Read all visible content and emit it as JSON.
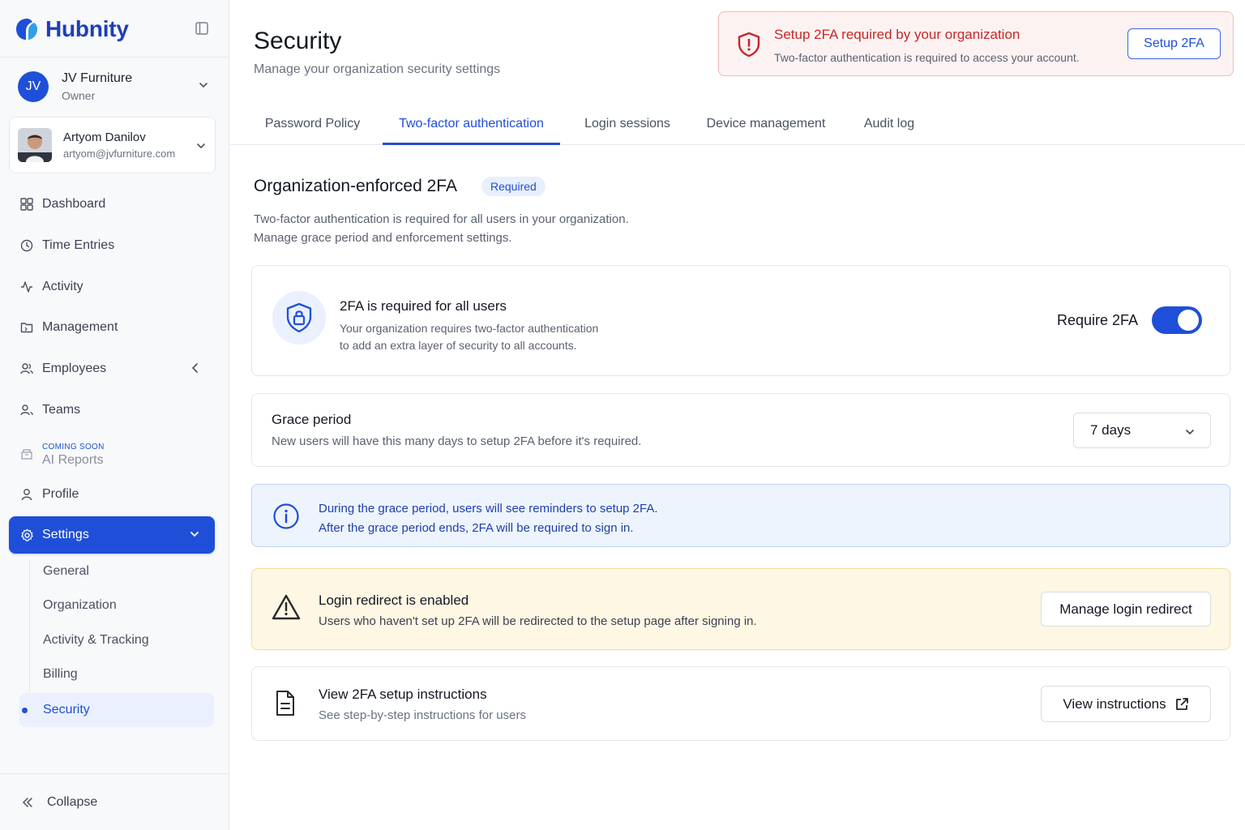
{
  "brand": {
    "name": "Hubnity",
    "accent": "#1f4fd8"
  },
  "org": {
    "initials": "JV",
    "name": "JV Furniture",
    "role": "Owner"
  },
  "user": {
    "name": "Artyom Danilov",
    "email": "artyom@jvfurniture.com"
  },
  "nav": {
    "items": [
      {
        "label": "Dashboard",
        "icon": "dashboard-icon"
      },
      {
        "label": "Time Entries",
        "icon": "clock-icon"
      },
      {
        "label": "Activity",
        "icon": "activity-icon"
      },
      {
        "label": "Management",
        "icon": "folder-icon"
      },
      {
        "label": "Employees",
        "icon": "users-icon"
      },
      {
        "label": "Teams",
        "icon": "team-icon"
      },
      {
        "label": "AI Reports",
        "badge": "COMING SOON",
        "icon": "reports-icon"
      },
      {
        "label": "Profile",
        "icon": "user-icon"
      },
      {
        "label": "Settings",
        "icon": "gear-icon",
        "active": true
      }
    ],
    "settings_sub": [
      "General",
      "Organization",
      "Activity & Tracking",
      "Billing",
      "Security"
    ],
    "active_sub": "Security",
    "collapse_label": "Collapse"
  },
  "header": {
    "title": "Security",
    "subtitle": "Manage your organization security settings"
  },
  "alert": {
    "title": "Setup 2FA required by your organization",
    "description": "Two-factor authentication is required to access your account.",
    "button": "Setup 2FA",
    "color": "#c62828"
  },
  "tabs": [
    {
      "label": "Password Policy"
    },
    {
      "label": "Two-factor authentication",
      "active": true
    },
    {
      "label": "Login sessions"
    },
    {
      "label": "Device management"
    },
    {
      "label": "Audit log"
    }
  ],
  "section": {
    "title": "Organization-enforced 2FA",
    "badge": "Required",
    "description_line1": "Two-factor authentication is required for all users in your organization.",
    "description_line2": "Manage grace period and enforcement settings."
  },
  "require_card": {
    "title": "2FA is required for all users",
    "description_line1": "Your organization requires two-factor authentication",
    "description_line2": "to add an extra layer of security to all accounts.",
    "toggle_label": "Require 2FA",
    "toggle_on": true
  },
  "grace_card": {
    "title": "Grace period",
    "description": "New users will have this many days to setup 2FA before it's required.",
    "selected_value": "7 days"
  },
  "info_box": {
    "line1": "During the grace period, users will see reminders to setup 2FA.",
    "line2": "After the grace period ends, 2FA will be required to sign in."
  },
  "redirect_box": {
    "title": "Login redirect is enabled",
    "description": "Users who haven't set up 2FA will be redirected to the setup page after signing in.",
    "button": "Manage login redirect"
  },
  "instructions_card": {
    "title": "View 2FA setup instructions",
    "description": "See step-by-step instructions for users",
    "button": "View instructions"
  }
}
